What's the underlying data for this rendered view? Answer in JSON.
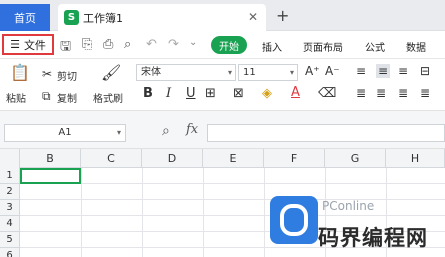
{
  "tabs": {
    "home_label": "首页",
    "doc_icon": "S",
    "doc_title": "工作簿1",
    "close_glyph": "✕",
    "add_glyph": "+"
  },
  "menubar": {
    "file_label": "文件",
    "start_label": "开始",
    "items": [
      "插入",
      "页面布局",
      "公式",
      "数据"
    ]
  },
  "ribbon": {
    "paste": "粘贴",
    "cut": "剪切",
    "copy": "复制",
    "format_painter": "格式刷",
    "font_name": "宋体",
    "font_size": "11",
    "bold": "B",
    "italic": "I",
    "underline": "U",
    "font_color_letter": "A"
  },
  "formula": {
    "cell_ref": "A1",
    "fx": "fx"
  },
  "grid": {
    "columns": [
      "B",
      "C",
      "D",
      "E",
      "F",
      "G",
      "H"
    ],
    "rows": [
      "1",
      "2",
      "3",
      "4",
      "5",
      "6"
    ]
  },
  "watermark": {
    "brand": "PConline",
    "cn": "码界编程网"
  },
  "colors": {
    "accent_green": "#1aa253",
    "home_blue": "#2f6fde",
    "highlight_red": "#e0393e"
  }
}
